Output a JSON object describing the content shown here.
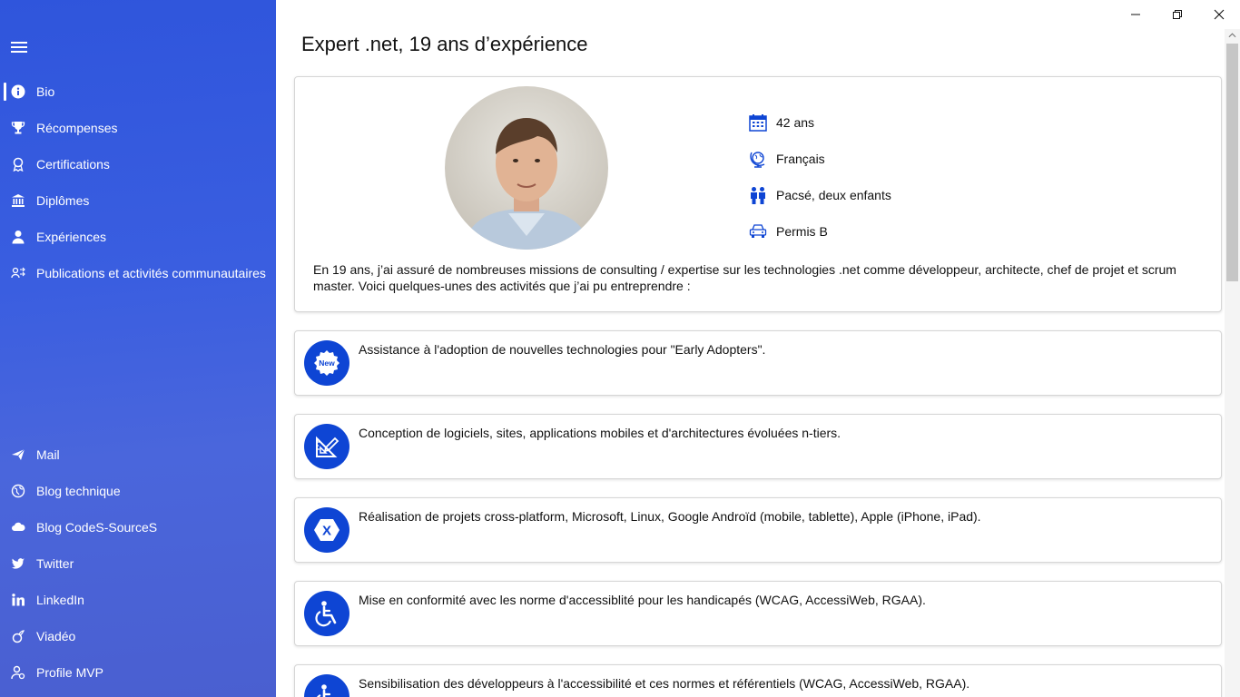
{
  "sidebar": {
    "menu_label": "Menu",
    "items": [
      {
        "label": "Bio",
        "icon": "info-icon",
        "active": true
      },
      {
        "label": "Récompenses",
        "icon": "trophy-icon"
      },
      {
        "label": "Certifications",
        "icon": "ribbon-icon"
      },
      {
        "label": "Diplômes",
        "icon": "bank-icon"
      },
      {
        "label": "Expériences",
        "icon": "person-icon"
      },
      {
        "label": "Publications et activités communautaires",
        "icon": "people-share-icon"
      }
    ],
    "links": [
      {
        "label": "Mail",
        "icon": "send-icon"
      },
      {
        "label": "Blog technique",
        "icon": "globe-icon"
      },
      {
        "label": "Blog CodeS-SourceS",
        "icon": "cloud-icon"
      },
      {
        "label": "Twitter",
        "icon": "twitter-icon"
      },
      {
        "label": "LinkedIn",
        "icon": "linkedin-icon"
      },
      {
        "label": "Viadéo",
        "icon": "viadeo-icon"
      },
      {
        "label": "Profile MVP",
        "icon": "profile-icon"
      }
    ]
  },
  "page": {
    "title": "Expert .net, 19 ans d’expérience"
  },
  "bio": {
    "info": [
      {
        "text": "42 ans",
        "icon": "calendar-icon"
      },
      {
        "text": "Français",
        "icon": "globe-icon"
      },
      {
        "text": "Pacsé, deux enfants",
        "icon": "family-icon"
      },
      {
        "text": "Permis B",
        "icon": "car-icon"
      }
    ],
    "text": "En 19 ans, j’ai assuré de nombreuses missions de consulting / expertise sur les technologies .net comme développeur, architecte, chef de projet et scrum master. Voici quelques-unes des activités que j’ai pu entreprendre :"
  },
  "activities": [
    {
      "text": "Assistance à l'adoption de nouvelles technologies pour \"Early Adopters\".",
      "icon": "new-badge-icon",
      "badge": "New"
    },
    {
      "text": "Conception de logiciels, sites, applications mobiles et d'architectures évoluées n-tiers.",
      "icon": "ruler-design-icon"
    },
    {
      "text": "Réalisation de projets cross-platform, Microsoft, Linux, Google Androïd (mobile, tablette), Apple (iPhone, iPad).",
      "icon": "xamarin-icon",
      "badge": "X"
    },
    {
      "text": "Mise en conformité avec les norme d'accessiblité pour les handicapés (WCAG, AccessiWeb, RGAA).",
      "icon": "accessibility-icon"
    },
    {
      "text": "Sensibilisation des développeurs à l'accessibilité et ces normes et référentiels (WCAG, AccessiWeb, RGAA).",
      "icon": "accessibility-icon"
    }
  ],
  "colors": {
    "accent": "#0e45d4",
    "sidebar_top": "#2f55dc",
    "sidebar_bottom": "#4a5fd0"
  }
}
